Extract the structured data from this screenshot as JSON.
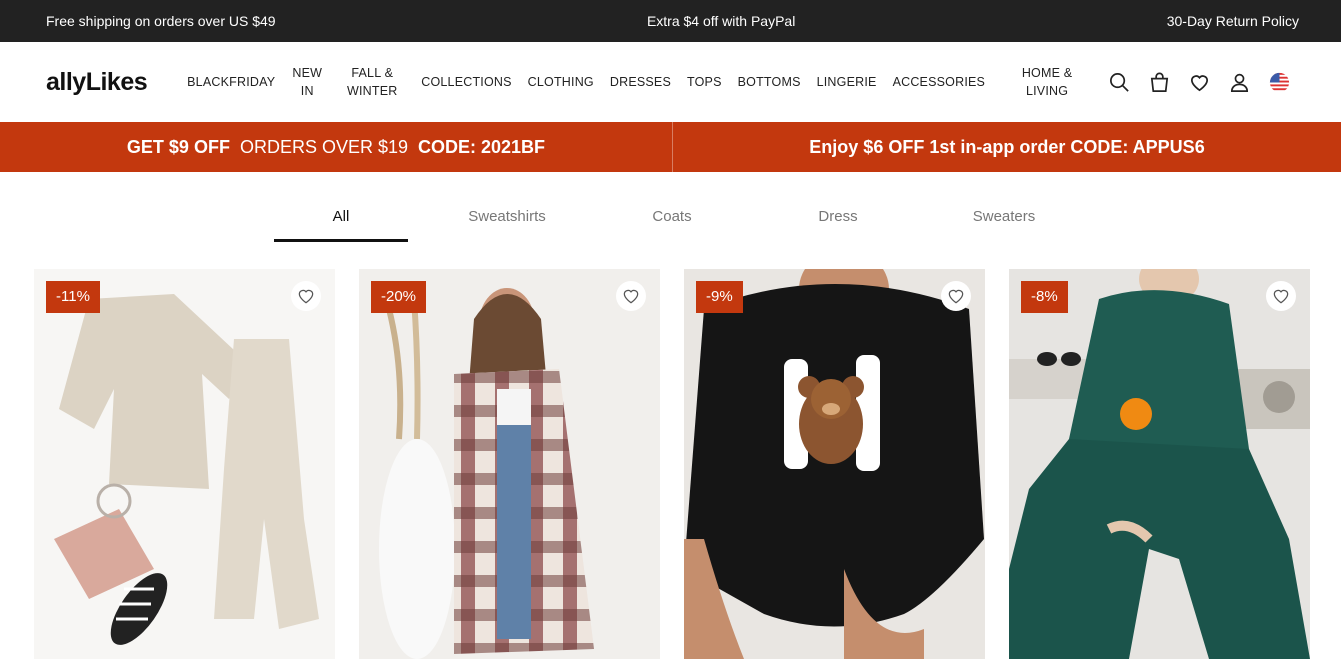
{
  "topbar": {
    "left": "Free shipping on orders over US $49",
    "center": "Extra $4 off with PayPal",
    "right": "30-Day Return Policy"
  },
  "header": {
    "logo": "allyLikes",
    "nav": [
      {
        "label": "BLACKFRIDAY"
      },
      {
        "label": "NEW IN"
      },
      {
        "label": "FALL & WINTER"
      },
      {
        "label": "COLLECTIONS"
      },
      {
        "label": "CLOTHING"
      },
      {
        "label": "DRESSES"
      },
      {
        "label": "TOPS"
      },
      {
        "label": "BOTTOMS"
      },
      {
        "label": "LINGERIE"
      },
      {
        "label": "ACCESSORIES"
      },
      {
        "label": "HOME & LIVING"
      }
    ],
    "icons": [
      "search-icon",
      "bag-icon",
      "heart-icon",
      "user-icon",
      "us-flag-icon"
    ]
  },
  "promo": {
    "left_bold1": "GET $9 OFF",
    "left_normal": "ORDERS OVER $19",
    "left_bold2": "CODE: 2021BF",
    "right": "Enjoy $6 OFF 1st in-app order CODE: APPUS6"
  },
  "tabs": [
    {
      "label": "All",
      "active": true
    },
    {
      "label": "Sweatshirts",
      "active": false
    },
    {
      "label": "Coats",
      "active": false
    },
    {
      "label": "Dress",
      "active": false
    },
    {
      "label": "Sweaters",
      "active": false
    }
  ],
  "products": [
    {
      "discount": "-11%",
      "image": "beige knit sweater and pants set flat lay"
    },
    {
      "discount": "-20%",
      "image": "woman in plaid shacket"
    },
    {
      "discount": "-9%",
      "image": "black sweatshirt with HI bear print"
    },
    {
      "discount": "-8%",
      "image": "green ribbed knit set"
    }
  ],
  "colors": {
    "topbar_bg": "#222222",
    "accent": "#c3380e"
  }
}
